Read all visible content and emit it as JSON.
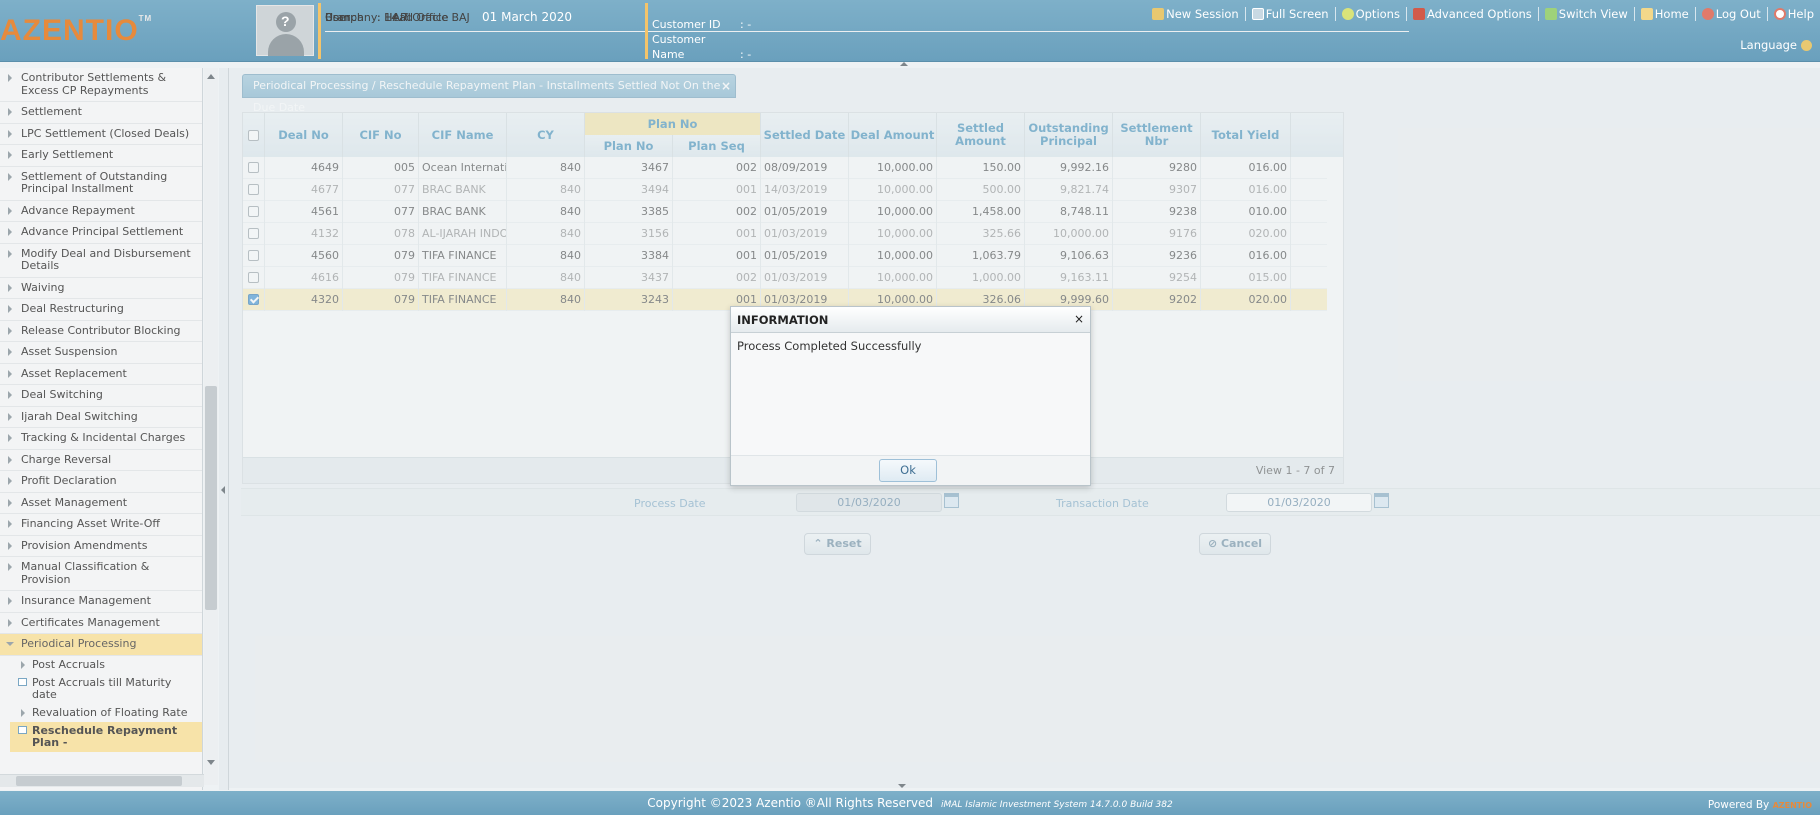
{
  "header": {
    "logo": "AZENTIO",
    "logo_tm": "TM",
    "user_label": "User",
    "user_value": ": HARI",
    "company_label": "Company",
    "company_value": ": 14.7 Oracle BAJ",
    "branch_label": "Branch",
    "branch_value": ": Head Office",
    "date": "01 March 2020",
    "customer_id_label": "Customer ID",
    "customer_id_value": ":    -",
    "customer_name_label": "Customer Name",
    "customer_name_value": ": -",
    "links": [
      "New Session",
      "Full Screen",
      "Options",
      "Advanced Options",
      "Switch View",
      "Home",
      "Log Out",
      "Help"
    ],
    "language": "Language"
  },
  "sidebar": {
    "items": [
      "Contributor Settlements & Excess CP Repayments",
      "Settlement",
      "LPC Settlement (Closed Deals)",
      "Early Settlement",
      "Settlement of Outstanding Principal Installment",
      "Advance Repayment",
      "Advance Principal Settlement",
      "Modify Deal and Disbursement Details",
      "Waiving",
      "Deal Restructuring",
      "Release Contributor Blocking",
      "Asset Suspension",
      "Asset Replacement",
      "Deal Switching",
      "Ijarah Deal Switching",
      "Tracking & Incidental Charges",
      "Charge Reversal",
      "Profit Declaration",
      "Asset Management",
      "Financing Asset Write-Off",
      "Provision Amendments",
      "Manual Classification & Provision",
      "Insurance Management",
      "Certificates Management"
    ],
    "active": "Periodical Processing",
    "subitems": [
      "Post Accruals",
      "Post Accruals till Maturity date",
      "Revaluation of Floating Rate"
    ],
    "selected_sub": "Reschedule Repayment Plan -"
  },
  "tab": {
    "title": "Periodical Processing / Reschedule Repayment Plan - Installments Settled Not On the Due Date",
    "close": "×"
  },
  "grid": {
    "headers": {
      "deal_no": "Deal No",
      "cif_no": "CIF No",
      "cif_name": "CIF Name",
      "cy": "CY",
      "plan_group": "Plan No",
      "plan_no": "Plan No",
      "plan_seq": "Plan Seq",
      "settled_date": "Settled Date",
      "deal_amount": "Deal Amount",
      "settled_amount": "Settled Amount",
      "outstanding_principal": "Outstanding Principal",
      "settlement_nbr": "Settlement Nbr",
      "total_yield": "Total Yield"
    },
    "rows": [
      {
        "deal_no": "4649",
        "cif_no": "005",
        "cif_name": "Ocean International",
        "cy": "840",
        "plan_no": "3467",
        "plan_seq": "002",
        "settled_date": "08/09/2019",
        "deal_amount": "10,000.00",
        "settled_amount": "150.00",
        "outstanding": "9,992.16",
        "settlement_nbr": "9280",
        "total_yield": "016.00",
        "dim": false,
        "checked": false
      },
      {
        "deal_no": "4677",
        "cif_no": "077",
        "cif_name": "BRAC BANK",
        "cy": "840",
        "plan_no": "3494",
        "plan_seq": "001",
        "settled_date": "14/03/2019",
        "deal_amount": "10,000.00",
        "settled_amount": "500.00",
        "outstanding": "9,821.74",
        "settlement_nbr": "9307",
        "total_yield": "016.00",
        "dim": true,
        "checked": false
      },
      {
        "deal_no": "4561",
        "cif_no": "077",
        "cif_name": "BRAC BANK",
        "cy": "840",
        "plan_no": "3385",
        "plan_seq": "002",
        "settled_date": "01/05/2019",
        "deal_amount": "10,000.00",
        "settled_amount": "1,458.00",
        "outstanding": "8,748.11",
        "settlement_nbr": "9238",
        "total_yield": "010.00",
        "dim": false,
        "checked": false
      },
      {
        "deal_no": "4132",
        "cif_no": "078",
        "cif_name": "AL-IJARAH INDONESIA",
        "cy": "840",
        "plan_no": "3156",
        "plan_seq": "001",
        "settled_date": "01/03/2019",
        "deal_amount": "10,000.00",
        "settled_amount": "325.66",
        "outstanding": "10,000.00",
        "settlement_nbr": "9176",
        "total_yield": "020.00",
        "dim": true,
        "checked": false
      },
      {
        "deal_no": "4560",
        "cif_no": "079",
        "cif_name": "TIFA FINANCE",
        "cy": "840",
        "plan_no": "3384",
        "plan_seq": "001",
        "settled_date": "01/05/2019",
        "deal_amount": "10,000.00",
        "settled_amount": "1,063.79",
        "outstanding": "9,106.63",
        "settlement_nbr": "9236",
        "total_yield": "016.00",
        "dim": false,
        "checked": false
      },
      {
        "deal_no": "4616",
        "cif_no": "079",
        "cif_name": "TIFA FINANCE",
        "cy": "840",
        "plan_no": "3437",
        "plan_seq": "002",
        "settled_date": "01/03/2019",
        "deal_amount": "10,000.00",
        "settled_amount": "1,000.00",
        "outstanding": "9,163.11",
        "settlement_nbr": "9254",
        "total_yield": "015.00",
        "dim": true,
        "checked": false
      },
      {
        "deal_no": "4320",
        "cif_no": "079",
        "cif_name": "TIFA FINANCE",
        "cy": "840",
        "plan_no": "3243",
        "plan_seq": "001",
        "settled_date": "01/03/2019",
        "deal_amount": "10,000.00",
        "settled_amount": "326.06",
        "outstanding": "9,999.60",
        "settlement_nbr": "9202",
        "total_yield": "020.00",
        "dim": false,
        "checked": true
      }
    ],
    "pager": "View 1 - 7 of 7"
  },
  "form": {
    "process_date_label": "Process Date",
    "process_date_value": "01/03/2020",
    "transaction_date_label": "Transaction Date",
    "transaction_date_value": "01/03/2020",
    "reset": "Reset",
    "cancel": "Cancel"
  },
  "dialog": {
    "title": "INFORMATION",
    "close": "×",
    "message": "Process Completed Successfully",
    "ok": "Ok"
  },
  "footer": {
    "copyright": "Copyright ©2023 Azentio ®All Rights Reserved",
    "version": "iMAL Islamic Investment System 14.7.0.0 Build 382",
    "powered": "Powered By",
    "powered_brand": "AZENTIO"
  },
  "colors": {
    "header": "#6aa0bd",
    "accent": "#e68a3c",
    "selected_row": "#fbeebe",
    "link": "#3f8db8"
  }
}
